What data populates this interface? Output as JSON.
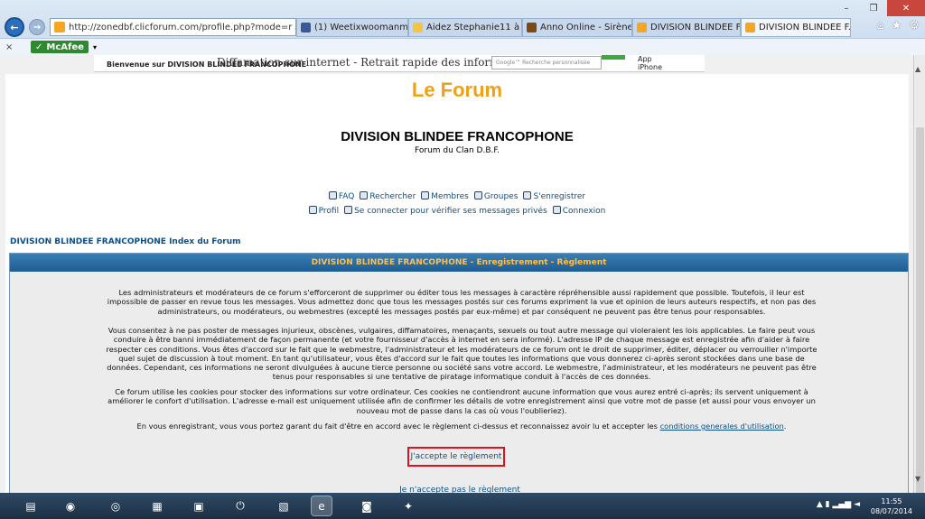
{
  "browser": {
    "url": "http://zonedbf.clicforum.com/profile.php?mode=r",
    "address_tools": "⌕ ▾ ≡ ↻",
    "tabs": [
      {
        "label": "(1) Weetixwoomanman",
        "color": "#3b5998",
        "active": false
      },
      {
        "label": "Aidez Stephanie11 à ga...",
        "color": "#f5c542",
        "active": false
      },
      {
        "label": "Anno Online - Sirène [R...",
        "color": "#7a4a12",
        "active": false
      },
      {
        "label": "DIVISION BLINDEE FRA...",
        "color": "#f5a623",
        "active": false
      },
      {
        "label": "DIVISION BLINDEE F...",
        "color": "#f5a623",
        "active": true
      }
    ],
    "tab_close": "×",
    "toolbar": {
      "close": "×",
      "mcafee": "McAfee",
      "mcafee_check": "✓",
      "dropdown": "▾"
    },
    "window_controls": {
      "minimize": "–",
      "maximize": "❒",
      "close": "✕"
    },
    "right_icons": [
      "⌂",
      "★",
      "⚙"
    ]
  },
  "page": {
    "topbar": {
      "welcome": "Bienvenue sur DIVISION BLINDEE FRANCOPHONE",
      "ghost_title": "Diffamation sur internet - Retrait rapide des informatio",
      "google_placeholder": "Google™ Recherche personnalisée",
      "app_iphone": "App\niPhone"
    },
    "logo": "Le Forum",
    "site_title": "DIVISION BLINDEE FRANCOPHONE",
    "site_subtitle": "Forum du Clan D.B.F.",
    "nav1": [
      "FAQ",
      "Rechercher",
      "Membres",
      "Groupes",
      "S'enregistrer"
    ],
    "nav2": [
      "Profil",
      "Se connecter pour vérifier ses messages privés",
      "Connexion"
    ],
    "breadcrumb": "DIVISION BLINDEE FRANCOPHONE Index du Forum",
    "panel_title": "DIVISION BLINDEE FRANCOPHONE - Enregistrement - Règlement",
    "paragraphs": {
      "p1": "Les administrateurs et modérateurs de ce forum s'efforceront de supprimer ou éditer tous les messages à caractère répréhensible aussi rapidement que possible. Toutefois, il leur est impossible de passer en revue tous les messages. Vous admettez donc que tous les messages postés sur ces forums expriment la vue et opinion de leurs auteurs respectifs, et non pas des administrateurs, ou modérateurs, ou webmestres (excepté les messages postés par eux-même) et par conséquent ne peuvent pas être tenus pour responsables.",
      "p2": "Vous consentez à ne pas poster de messages injurieux, obscènes, vulgaires, diffamatoires, menaçants, sexuels ou tout autre message qui violeraient les lois applicables. Le faire peut vous conduire à être banni immédiatement de façon permanente (et votre fournisseur d'accès à internet en sera informé). L'adresse IP de chaque message est enregistrée afin d'aider à faire respecter ces conditions. Vous êtes d'accord sur le fait que le webmestre, l'administrateur et les modérateurs de ce forum ont le droit de supprimer, éditer, déplacer ou verrouiller n'importe quel sujet de discussion à tout moment. En tant qu'utilisateur, vous êtes d'accord sur le fait que toutes les informations que vous donnerez ci-après seront stockées dans une base de données. Cependant, ces informations ne seront divulguées à aucune tierce personne ou société sans votre accord. Le webmestre, l'administrateur, et les modérateurs ne peuvent pas être tenus pour responsables si une tentative de piratage informatique conduit à l'accès de ces données.",
      "p3": "Ce forum utilise les cookies pour stocker des informations sur votre ordinateur. Ces cookies ne contiendront aucune information que vous aurez entré ci-après; ils servent uniquement à améliorer le confort d'utilisation. L'adresse e-mail est uniquement utilisée afin de confirmer les détails de votre enregistrement ainsi que votre mot de passe (et aussi pour vous envoyer un nouveau mot de passe dans la cas où vous l'oublieriez).",
      "p4_text": "En vous enregistrant, vous vous portez garant du fait d'être en accord avec le règlement ci-dessus et reconnaissez avoir lu et accepter les",
      "p4_link": "conditions generales d'utilisation",
      "p4_end": "."
    },
    "accept": "J'accepte le règlement",
    "reject": "Je n'accepte pas le règlement"
  },
  "taskbar": {
    "icons": [
      "▤",
      "◉",
      "◎",
      "▦",
      "▣",
      "⏻",
      "▧",
      "e",
      "◙",
      "✦"
    ],
    "tray": "▲ ▮ ▂▄▆ ◄",
    "time": "11:55",
    "date": "08/07/2014"
  }
}
